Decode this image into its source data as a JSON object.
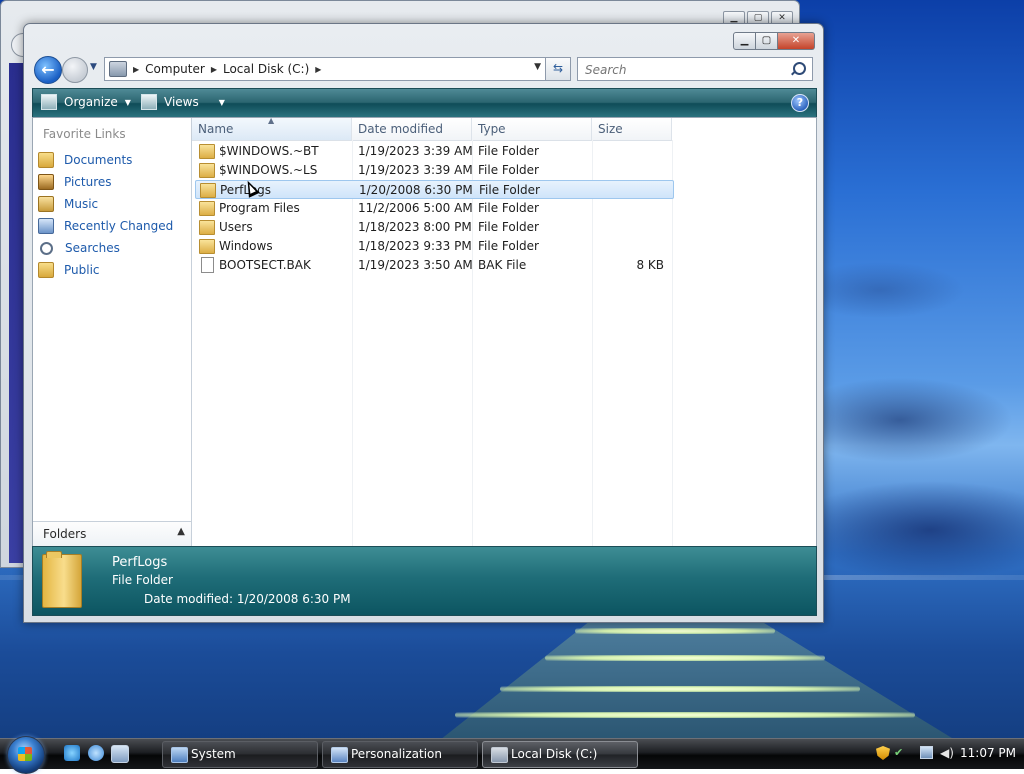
{
  "window": {
    "minimize_icon": "minimize-icon",
    "maximize_icon": "maximize-icon",
    "close_icon": "close-icon"
  },
  "address_bar": {
    "crumbs": [
      "Computer",
      "Local Disk (C:)"
    ]
  },
  "search": {
    "placeholder": "Search"
  },
  "toolbar": {
    "organize": "Organize",
    "views": "Views",
    "help": "?"
  },
  "nav_pane": {
    "heading": "Favorite Links",
    "links": [
      {
        "label": "Documents",
        "icon": "folder-icon"
      },
      {
        "label": "Pictures",
        "icon": "pictures-icon"
      },
      {
        "label": "Music",
        "icon": "music-icon"
      },
      {
        "label": "Recently Changed",
        "icon": "recent-icon"
      },
      {
        "label": "Searches",
        "icon": "search-icon"
      },
      {
        "label": "Public",
        "icon": "folder-icon"
      }
    ],
    "folders_label": "Folders"
  },
  "file_list": {
    "columns": [
      "Name",
      "Date modified",
      "Type",
      "Size"
    ],
    "rows": [
      {
        "name": "$WINDOWS.~BT",
        "date": "1/19/2023 3:39 AM",
        "type": "File Folder",
        "size": "",
        "icon": "folder-icon"
      },
      {
        "name": "$WINDOWS.~LS",
        "date": "1/19/2023 3:39 AM",
        "type": "File Folder",
        "size": "",
        "icon": "folder-icon"
      },
      {
        "name": "PerfLogs",
        "date": "1/20/2008 6:30 PM",
        "type": "File Folder",
        "size": "",
        "icon": "folder-icon",
        "selected": true
      },
      {
        "name": "Program Files",
        "date": "11/2/2006 5:00 AM",
        "type": "File Folder",
        "size": "",
        "icon": "folder-icon"
      },
      {
        "name": "Users",
        "date": "1/18/2023 8:00 PM",
        "type": "File Folder",
        "size": "",
        "icon": "folder-icon"
      },
      {
        "name": "Windows",
        "date": "1/18/2023 9:33 PM",
        "type": "File Folder",
        "size": "",
        "icon": "folder-icon"
      },
      {
        "name": "BOOTSECT.BAK",
        "date": "1/19/2023 3:50 AM",
        "type": "BAK File",
        "size": "8 KB",
        "icon": "file-icon"
      }
    ]
  },
  "details": {
    "name": "PerfLogs",
    "type": "File Folder",
    "modified": "Date modified: 1/20/2008 6:30 PM"
  },
  "taskbar": {
    "buttons": [
      {
        "label": "System",
        "icon": "system-icon"
      },
      {
        "label": "Personalization",
        "icon": "personalization-icon"
      },
      {
        "label": "Local Disk (C:)",
        "icon": "disk-icon",
        "active": true
      }
    ],
    "clock": "11:07 PM"
  }
}
